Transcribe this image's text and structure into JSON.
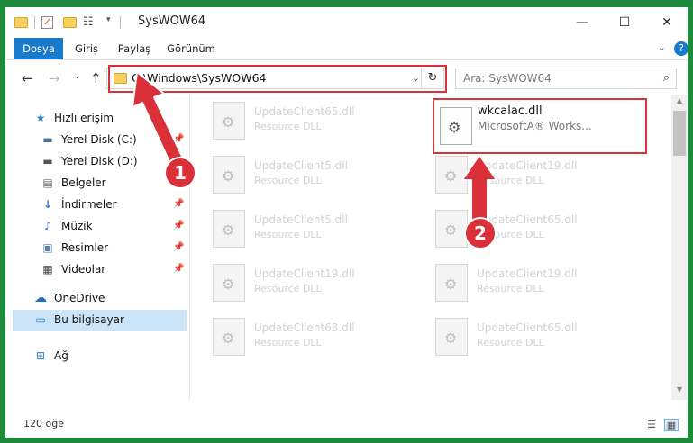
{
  "title": "SysWOW64",
  "window_controls": {
    "minimize": "—",
    "maximize": "☐",
    "close": "✕"
  },
  "ribbon": {
    "tabs": [
      "Dosya",
      "Giriş",
      "Paylaş",
      "Görünüm"
    ],
    "help": "?"
  },
  "address": {
    "path": "C:\\Windows\\SysWOW64"
  },
  "search": {
    "placeholder": "Ara: SysWOW64"
  },
  "sidebar": {
    "items": [
      {
        "label": "Hızlı erişim",
        "icon": "star-icon",
        "pinned": false
      },
      {
        "label": "Yerel Disk (C:)",
        "icon": "drive-icon",
        "pinned": true
      },
      {
        "label": "Yerel Disk (D:)",
        "icon": "drive-icon",
        "pinned": true
      },
      {
        "label": "Belgeler",
        "icon": "documents-icon",
        "pinned": true
      },
      {
        "label": "İndirmeler",
        "icon": "download-icon",
        "pinned": true
      },
      {
        "label": "Müzik",
        "icon": "music-icon",
        "pinned": true
      },
      {
        "label": "Resimler",
        "icon": "pictures-icon",
        "pinned": true
      },
      {
        "label": "Videolar",
        "icon": "video-icon",
        "pinned": true
      },
      {
        "label": "OneDrive",
        "icon": "cloud-icon",
        "pinned": false
      },
      {
        "label": "Bu bilgisayar",
        "icon": "computer-icon",
        "pinned": false,
        "selected": true
      },
      {
        "label": "Ağ",
        "icon": "network-icon",
        "pinned": false
      }
    ]
  },
  "files": {
    "featured": {
      "name": "wkcalac.dll",
      "desc": "MicrosoftA® Works..."
    },
    "ghost": [
      {
        "name": "UpdateClient65.dll",
        "desc": "Resource DLL"
      },
      {
        "name": "UpdateClient5.dll",
        "desc": "Resource DLL"
      },
      {
        "name": "UpdateClient19.dll",
        "desc": "Resource DLL"
      },
      {
        "name": "UpdateClient5.dll",
        "desc": "Resource DLL"
      },
      {
        "name": "UpdateClient65.dll",
        "desc": "Resource DLL"
      },
      {
        "name": "UpdateClient19.dll",
        "desc": "Resource DLL"
      },
      {
        "name": "UpdateClient19.dll",
        "desc": "Resource DLL"
      },
      {
        "name": "UpdateClient63.dll",
        "desc": "Resource DLL"
      },
      {
        "name": "UpdateClient65.dll",
        "desc": "Resource DLL"
      }
    ]
  },
  "status": {
    "count": "120 öğe"
  },
  "annotations": {
    "step1": "1",
    "step2": "2",
    "color": "#d9303a"
  }
}
